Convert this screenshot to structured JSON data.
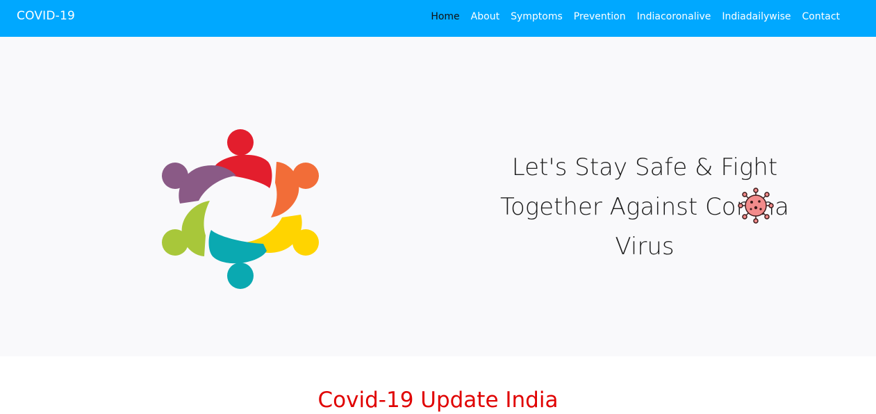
{
  "navbar": {
    "brand": "COVID-19",
    "links": [
      {
        "label": "Home",
        "active": true
      },
      {
        "label": "About"
      },
      {
        "label": "Symptoms"
      },
      {
        "label": "Prevention"
      },
      {
        "label": "Indiacoronalive"
      },
      {
        "label": "Indiadailywise"
      },
      {
        "label": "Contact"
      }
    ],
    "color": "#00a8ff"
  },
  "hero": {
    "headline_line1": "Let's Stay Safe & Fight",
    "headline_line2": "Together Against Corona",
    "headline_line3": "Virus",
    "logo_icon": "community-circle-icon",
    "virus_icon": "coronavirus-icon"
  },
  "section": {
    "title": "Covid-19 Update India",
    "title_color": "#e00000"
  }
}
